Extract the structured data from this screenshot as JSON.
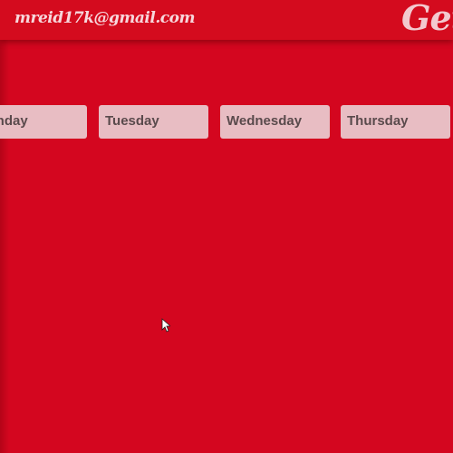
{
  "header": {
    "email": "mreid17k@gmail.com",
    "logo_text": "GetT"
  },
  "days": [
    {
      "label": "Monday"
    },
    {
      "label": "Tuesday"
    },
    {
      "label": "Wednesday"
    },
    {
      "label": "Thursday"
    }
  ],
  "colors": {
    "background": "#d4061f",
    "day_card": "#e8bdc3",
    "day_text": "#5a4a4c"
  }
}
